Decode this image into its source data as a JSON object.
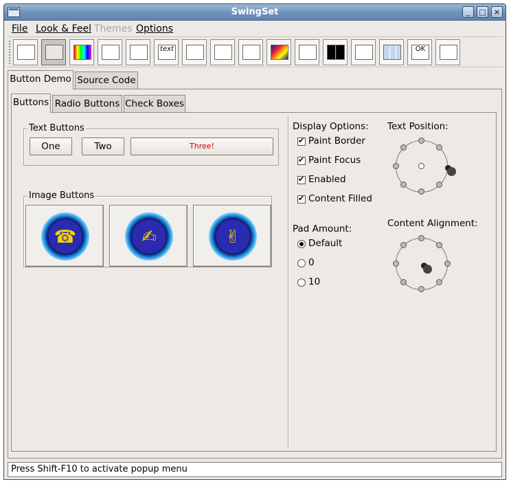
{
  "window": {
    "title": "SwingSet"
  },
  "menu": [
    {
      "label": "File",
      "enabled": true
    },
    {
      "label": "Look & Feel",
      "enabled": true
    },
    {
      "label": "Themes",
      "enabled": false
    },
    {
      "label": "Options",
      "enabled": true
    }
  ],
  "toolbar": {
    "tools": [
      "button-demo-icon",
      "toggle-demo-icon",
      "colorchooser-icon",
      "combobox-icon",
      "filechooser-icon",
      "editor-text-icon",
      "list-icon",
      "optionpane-icon",
      "progressbar-icon",
      "scrollpane-icon",
      "slider-icon",
      "splitpane-icon",
      "tabbedpane-icon",
      "table-icon",
      "tooltip-icon",
      "tree-icon"
    ],
    "pressed_index": 1,
    "text_tool_label": "text",
    "ok_tool_label": "OK"
  },
  "outer_tabs": [
    {
      "label": "Button Demo",
      "selected": true
    },
    {
      "label": "Source Code",
      "selected": false
    }
  ],
  "inner_tabs": [
    {
      "label": "Buttons",
      "selected": true
    },
    {
      "label": "Radio Buttons",
      "selected": false
    },
    {
      "label": "Check Boxes",
      "selected": false
    }
  ],
  "text_buttons": {
    "title": "Text Buttons",
    "buttons": [
      "One",
      "Two",
      "Three!"
    ],
    "three_color": "#cc0000"
  },
  "image_buttons": {
    "title": "Image Buttons",
    "icons": [
      "phone-icon",
      "writing-hand-icon",
      "peace-hand-icon"
    ]
  },
  "display_options": {
    "title": "Display Options:",
    "items": [
      {
        "label": "Paint Border",
        "checked": true
      },
      {
        "label": "Paint Focus",
        "checked": true
      },
      {
        "label": "Enabled",
        "checked": true
      },
      {
        "label": "Content Filled",
        "checked": true
      }
    ]
  },
  "pad_amount": {
    "title": "Pad Amount:",
    "options": [
      {
        "label": "Default",
        "selected": true
      },
      {
        "label": "0",
        "selected": false
      },
      {
        "label": "10",
        "selected": false
      }
    ]
  },
  "text_position": {
    "title": "Text Position:",
    "selected": "right"
  },
  "content_alignment": {
    "title": "Content Alignment:",
    "selected": "center"
  },
  "status": {
    "text": "Press Shift-F10 to activate popup menu"
  }
}
